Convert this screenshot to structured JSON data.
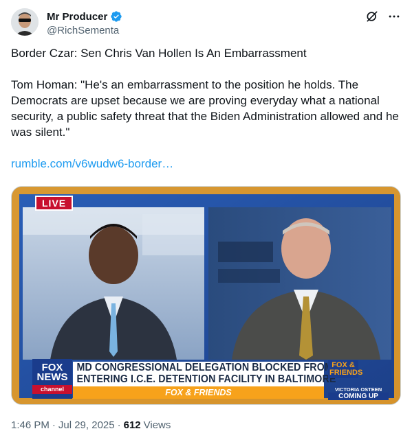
{
  "author": {
    "display_name": "Mr Producer",
    "handle": "@RichSementa",
    "verified": true,
    "verified_color": "#1d9bf0"
  },
  "header_actions": {
    "grok_icon": "grok-icon",
    "more_icon": "more-icon"
  },
  "tweet": {
    "headline": "Border Czar: Sen Chris Van Hollen Is An Embarrassment",
    "body": "Tom Homan: \"He's an embarrassment to the position he holds. The Democrats are upset because we are proving everyday what a national security, a public safety threat that the Biden Administration allowed and he was silent.\"",
    "link": "rumble.com/v6wudw6-border…"
  },
  "media": {
    "live_label": "LIVE",
    "network_logo": "FOX NEWS",
    "network_sub": "channel",
    "chyron_line1": "MD CONGRESSIONAL DELEGATION BLOCKED FROM",
    "chyron_line2": "ENTERING I.C.E. DETENTION FACILITY IN BALTIMORE",
    "show_name": "FOX & FRIENDS",
    "show_logo": "FOX & FRIENDS",
    "upnext_name": "VICTORIA OSTEEN",
    "upnext_label": "COMING UP",
    "accent_color": "#f7a21b",
    "navy_color": "#1a3c8c",
    "red_color": "#c8102e"
  },
  "meta": {
    "time": "1:46 PM",
    "separator": "·",
    "date": "Jul 29, 2025",
    "views_count": "612",
    "views_label": "Views"
  }
}
